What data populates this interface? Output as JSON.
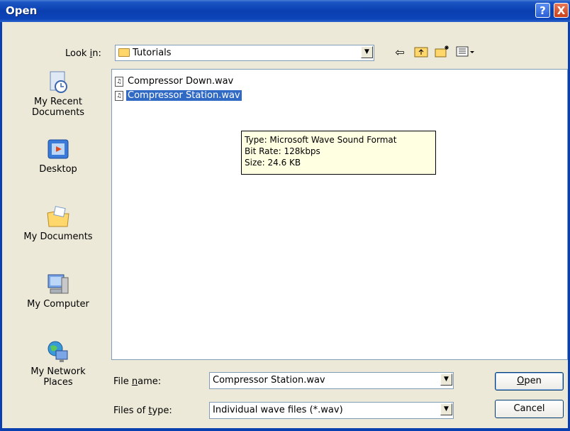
{
  "window": {
    "title": "Open",
    "help_glyph": "?",
    "close_glyph": "X"
  },
  "toolbar": {
    "lookin_label_prefix": "Look ",
    "lookin_label_accel": "i",
    "lookin_label_suffix": "n:",
    "lookin_value": "Tutorials",
    "icons": [
      "back-icon",
      "up-folder-icon",
      "new-folder-icon",
      "views-menu-icon"
    ]
  },
  "places": [
    {
      "label": "My Recent Documents",
      "icon": "recent-documents-icon"
    },
    {
      "label": "Desktop",
      "icon": "desktop-icon"
    },
    {
      "label": "My Documents",
      "icon": "my-documents-icon"
    },
    {
      "label": "My Computer",
      "icon": "my-computer-icon"
    },
    {
      "label": "My Network Places",
      "icon": "network-places-icon"
    }
  ],
  "files": [
    {
      "name": "Compressor Down.wav",
      "selected": false
    },
    {
      "name": "Compressor Station.wav",
      "selected": true
    }
  ],
  "tooltip": {
    "type": "Type: Microsoft Wave Sound Format",
    "bitrate": "Bit Rate: 128kbps",
    "size": "Size: 24.6 KB"
  },
  "form": {
    "filename_label_prefix": "File ",
    "filename_label_accel": "n",
    "filename_label_suffix": "ame:",
    "filename_value": "Compressor Station.wav",
    "filetype_label_prefix": "Files of ",
    "filetype_label_accel": "t",
    "filetype_label_suffix": "ype:",
    "filetype_value": "Individual wave files (*.wav)"
  },
  "buttons": {
    "open_accel": "O",
    "open_rest": "pen",
    "cancel": "Cancel"
  },
  "colors": {
    "titlebar": "#0a3fb0",
    "selection": "#316ac5",
    "tooltip_bg": "#ffffe1",
    "dialog_bg": "#ece9d8"
  }
}
